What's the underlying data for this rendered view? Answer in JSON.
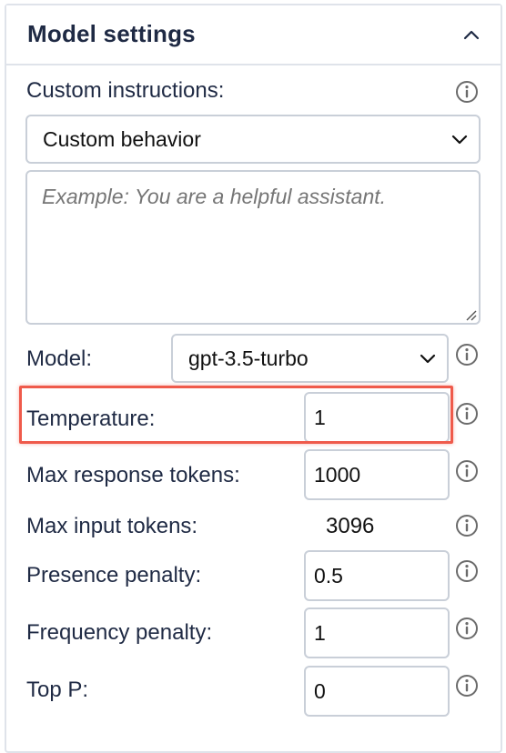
{
  "panel": {
    "title": "Model settings"
  },
  "custom_instructions": {
    "label": "Custom instructions:",
    "selected": "Custom behavior",
    "placeholder": "Example: You are a helpful assistant."
  },
  "model": {
    "label": "Model:",
    "selected": "gpt-3.5-turbo"
  },
  "temperature": {
    "label": "Temperature:",
    "value": "1"
  },
  "max_response_tokens": {
    "label": "Max response tokens:",
    "value": "1000"
  },
  "max_input_tokens": {
    "label": "Max input tokens:",
    "value": "3096"
  },
  "presence_penalty": {
    "label": "Presence penalty:",
    "value": "0.5"
  },
  "frequency_penalty": {
    "label": "Frequency penalty:",
    "value": "1"
  },
  "top_p": {
    "label": "Top P:",
    "value": "0"
  },
  "colors": {
    "highlight": "#ef5a4b",
    "border": "#c9cfd8",
    "text": "#1f2a44",
    "placeholder": "#8a94a6"
  },
  "icons": {
    "collapse": "chevron-up-icon",
    "info": "info-icon",
    "dropdown": "chevron-down-icon"
  }
}
